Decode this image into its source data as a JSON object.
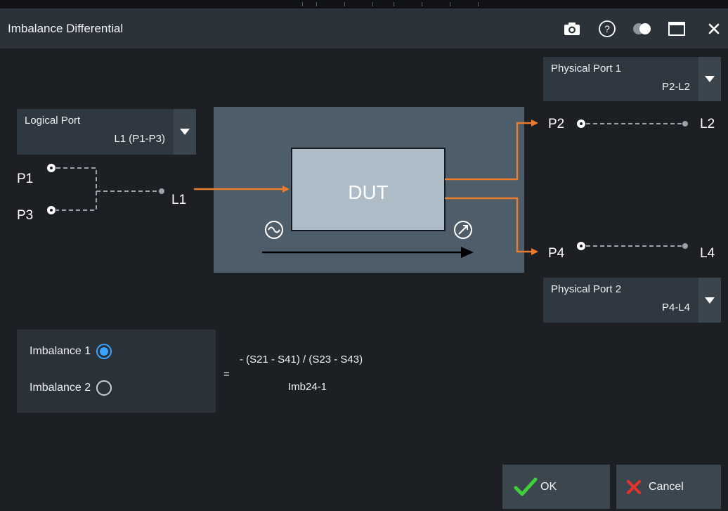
{
  "window": {
    "title": "Imbalance Differential",
    "icons": [
      "camera-icon",
      "help-icon",
      "toggle-icon",
      "maximize-icon",
      "close-icon"
    ]
  },
  "logical_port": {
    "label": "Logical Port",
    "value": "L1 (P1-P3)"
  },
  "physical_port_1": {
    "label": "Physical Port 1",
    "value": "P2-L2"
  },
  "physical_port_2": {
    "label": "Physical Port 2",
    "value": "P4-L4"
  },
  "diagram": {
    "dut_label": "DUT",
    "left_ports": [
      "P1",
      "P3"
    ],
    "logical_label": "L1",
    "right_ports": [
      {
        "port": "P2",
        "logical": "L2"
      },
      {
        "port": "P4",
        "logical": "L4"
      }
    ]
  },
  "imbalance": {
    "options": [
      {
        "label": "Imbalance 1",
        "selected": true
      },
      {
        "label": "Imbalance 2",
        "selected": false
      }
    ],
    "equals": "=",
    "formula": "- (S21 - S41) / (S23 - S43)",
    "name": "Imb24-1"
  },
  "buttons": {
    "ok": "OK",
    "cancel": "Cancel"
  },
  "colors": {
    "accent_orange": "#e87c2f",
    "radio_blue": "#3aa3ff",
    "ok_green": "#3fd13a",
    "cancel_red": "#e8332b"
  }
}
